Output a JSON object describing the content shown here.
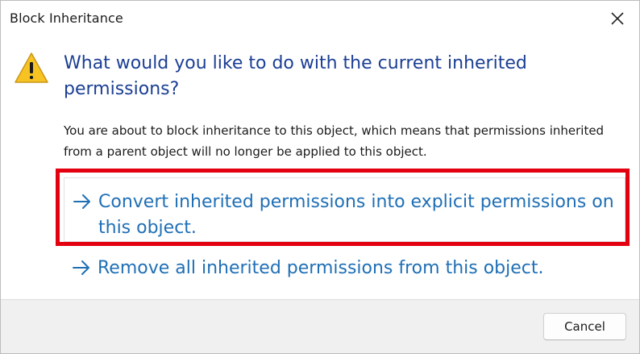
{
  "window": {
    "title": "Block Inheritance",
    "close_icon": "close-icon"
  },
  "content": {
    "icon": "warning-icon",
    "heading": "What would you like to do with the current inherited permissions?",
    "description": "You are about to block inheritance to this object, which means that permissions inherited from a parent object will no longer be applied to this object.",
    "options": [
      {
        "icon": "arrow-right-icon",
        "label": "Convert inherited permissions into explicit permissions on this object.",
        "highlighted": true
      },
      {
        "icon": "arrow-right-icon",
        "label": "Remove all inherited permissions from this object.",
        "highlighted": false
      }
    ]
  },
  "footer": {
    "cancel_label": "Cancel"
  },
  "colors": {
    "heading": "#1c3f94",
    "link": "#1f6fb5",
    "highlight_border": "#e3000f",
    "warning_fill": "#f7c323",
    "footer_bg": "#f0f0f0"
  }
}
